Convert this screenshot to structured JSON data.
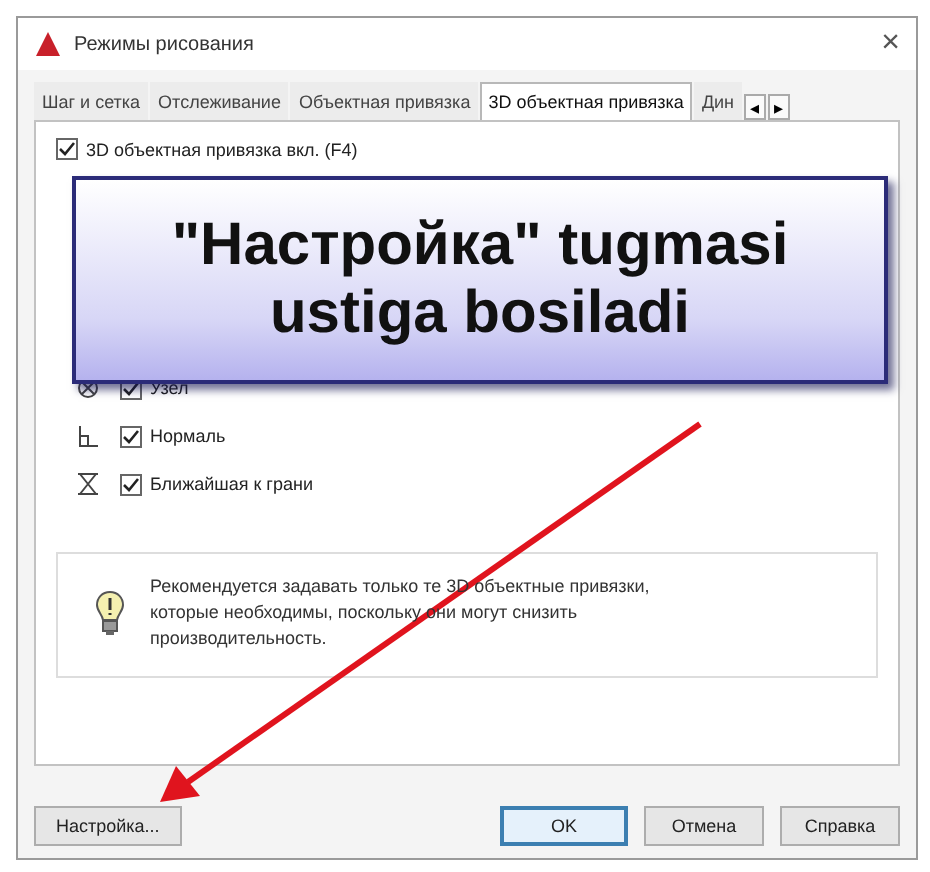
{
  "window": {
    "title": "Режимы рисования",
    "close": "×"
  },
  "tabs": [
    {
      "label": "Шаг и сетка",
      "selected": false
    },
    {
      "label": "Отслеживание",
      "selected": false
    },
    {
      "label": "Объектная привязка",
      "selected": false
    },
    {
      "label": "3D объектная привязка",
      "selected": true
    },
    {
      "label": "Дин",
      "selected": false
    }
  ],
  "tab_scroll": [
    "◂",
    "▸"
  ],
  "panel": {
    "master": {
      "label": "3D объектная привязка вкл. (F4)",
      "checked": true
    },
    "snaps": [
      {
        "kind": "node",
        "label": "Узел",
        "checked": true
      },
      {
        "kind": "normal",
        "label": "Нормаль",
        "checked": true
      },
      {
        "kind": "nearest_face",
        "label": "Ближайшая к грани",
        "checked": true
      }
    ],
    "hint": "Рекомендуется задавать только те 3D объектные привязки, которые необходимы, поскольку они могут снизить производительность."
  },
  "callout": {
    "lines": [
      "\"Настройка\" tugmasi",
      "ustiga bosiladi"
    ]
  },
  "buttons": [
    {
      "label": "Настройка...",
      "default": false
    },
    {
      "label": "OK",
      "default": true
    },
    {
      "label": "Отмена",
      "default": false
    },
    {
      "label": "Справка",
      "default": false
    }
  ]
}
